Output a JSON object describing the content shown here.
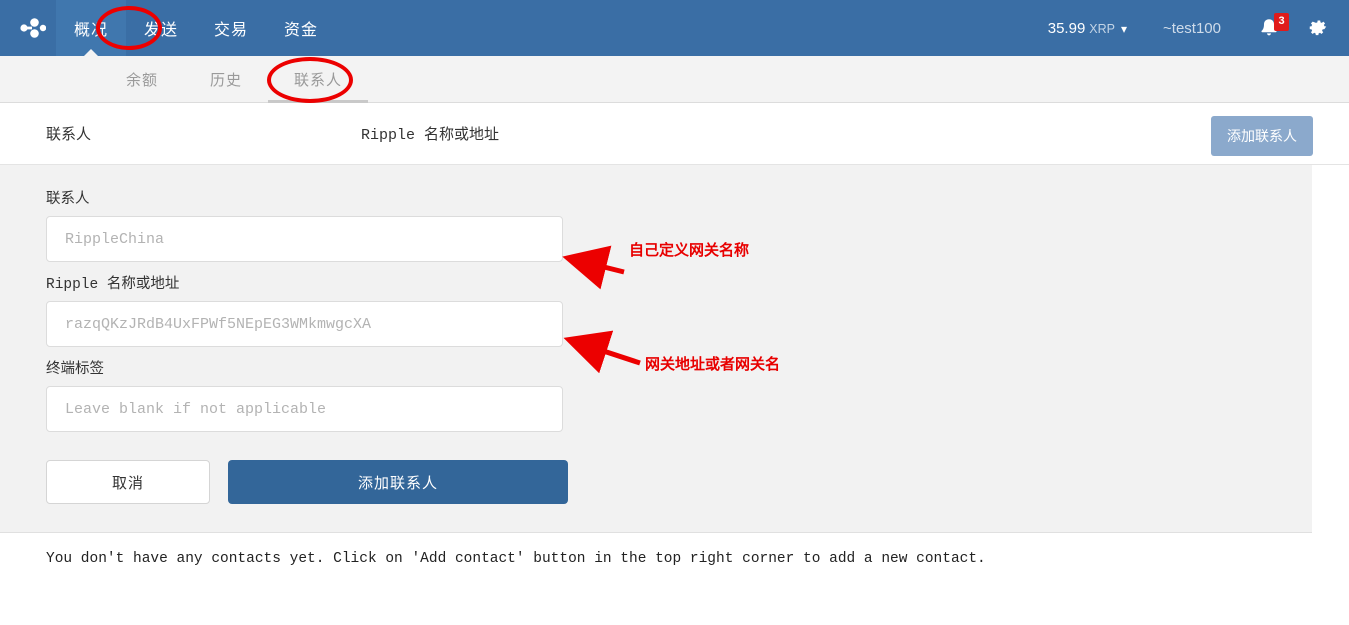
{
  "header": {
    "logo_icon": "ripple-logo-icon",
    "nav_items": [
      {
        "label": "概况",
        "active": true
      },
      {
        "label": "发送",
        "active": false
      },
      {
        "label": "交易",
        "active": false
      },
      {
        "label": "资金",
        "active": false
      }
    ],
    "balance": {
      "amount": "35.99",
      "currency": "XRP",
      "chevron": "⌄"
    },
    "username": "~test100",
    "bell_icon": "bell-icon",
    "notification_count": "3",
    "gear_icon": "gear-icon",
    "colors": {
      "navbar_bg": "#3a6ea5",
      "active_nav_bg": "#4077ae",
      "badge": "#e01b1b"
    }
  },
  "subnav": {
    "tabs": [
      {
        "label": "余额",
        "active": false
      },
      {
        "label": "历史",
        "active": false
      },
      {
        "label": "联系人",
        "active": true
      }
    ]
  },
  "table": {
    "headers": {
      "contact": "联系人",
      "address": "Ripple 名称或地址"
    },
    "add_contact_label": "添加联系人",
    "rows": []
  },
  "form": {
    "fields": [
      {
        "name": "contact-name",
        "label": "联系人",
        "value": "",
        "placeholder": "RippleChina"
      },
      {
        "name": "ripple-address",
        "label": "Ripple 名称或地址",
        "value": "",
        "placeholder": "razqQKzJRdB4UxFPWf5NEpEG3WMkmwgcXA"
      },
      {
        "name": "destination-tag",
        "label": "终端标签",
        "value": "",
        "placeholder": "Leave blank if not applicable"
      }
    ],
    "cancel_label": "取消",
    "submit_label": "添加联系人"
  },
  "empty_state": {
    "message": "You don't have any contacts yet. Click on 'Add contact' button in the top right corner to add a new contact."
  },
  "annotations": {
    "color": "#e80000",
    "items": [
      {
        "text": "自己定义网关名称",
        "target": "contact-name-input"
      },
      {
        "text": "网关地址或者网关名",
        "target": "ripple-address-input"
      }
    ],
    "circled": [
      "概况",
      "联系人"
    ]
  }
}
